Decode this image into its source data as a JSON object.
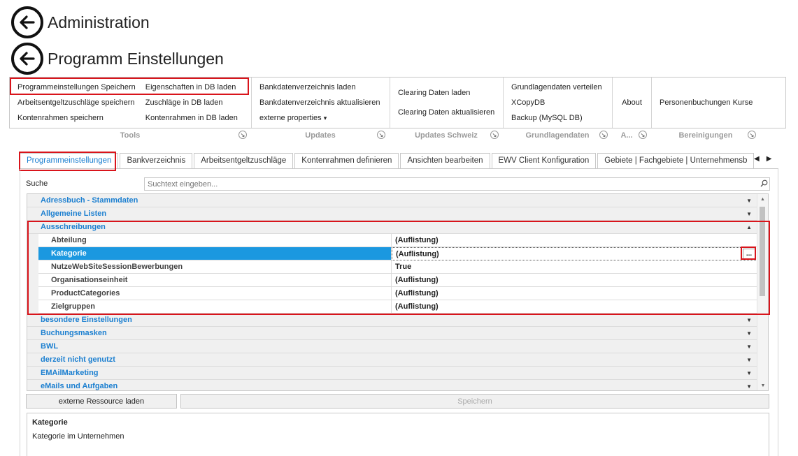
{
  "header": {
    "title1": "Administration",
    "title2": "Programm Einstellungen"
  },
  "ribbon": {
    "groups": [
      {
        "label": "Tools",
        "buttons": [
          [
            "Programmeinstellungen Speichern",
            "Arbeitsentgeltzuschläge speichern",
            "Kontenrahmen speichern"
          ],
          [
            "Eigenschaften in DB laden",
            "Zuschläge in DB laden",
            "Kontenrahmen in DB laden"
          ]
        ]
      },
      {
        "label": "Updates",
        "buttons": [
          [
            "Bankdatenverzeichnis laden",
            "Bankdatenverzeichnis aktualisieren",
            "externe properties"
          ]
        ]
      },
      {
        "label": "Updates Schweiz",
        "buttons": [
          [
            "Clearing Daten laden",
            "Clearing Daten aktualisieren"
          ]
        ]
      },
      {
        "label": "Grundlagendaten",
        "buttons": [
          [
            "Grundlagendaten verteilen",
            "XCopyDB",
            "Backup (MySQL DB)"
          ]
        ]
      },
      {
        "label": "A...",
        "buttons": [
          [
            "About"
          ]
        ]
      },
      {
        "label": "Bereinigungen",
        "buttons": [
          [
            "Personenbuchungen Kurse"
          ]
        ]
      }
    ],
    "dropdown_arrow": "▾"
  },
  "tabs": [
    "Programmeinstellungen",
    "Bankverzeichnis",
    "Arbeitsentgeltzuschläge",
    "Kontenrahmen definieren",
    "Ansichten bearbeiten",
    "EWV Client Konfiguration",
    "Gebiete | Fachgebiete | Unternehmensb"
  ],
  "active_tab": "Programmeinstellungen",
  "search": {
    "label": "Suche",
    "placeholder": "Suchtext eingeben..."
  },
  "grid": {
    "categories_before": [
      "Adressbuch - Stammdaten",
      "Allgemeine Listen"
    ],
    "expanded_category": "Ausschreibungen",
    "properties": [
      {
        "name": "Abteilung",
        "value": "(Auflistung)"
      },
      {
        "name": "Kategorie",
        "value": "(Auflistung)",
        "selected": true
      },
      {
        "name": "NutzeWebSiteSessionBewerbungen",
        "value": "True"
      },
      {
        "name": "Organisationseinheit",
        "value": "(Auflistung)"
      },
      {
        "name": "ProductCategories",
        "value": "(Auflistung)"
      },
      {
        "name": "Zielgruppen",
        "value": "(Auflistung)"
      }
    ],
    "categories_after": [
      "besondere Einstellungen",
      "Buchungsmasken",
      "BWL",
      "derzeit nicht genutzt",
      "EMAilMarketing",
      "eMails und Aufgaben"
    ],
    "ellipsis": "..."
  },
  "buttons": {
    "load_resource": "externe Ressource laden",
    "save": "Speichern"
  },
  "description": {
    "title": "Kategorie",
    "text": "Kategorie im Unternehmen"
  },
  "colors": {
    "accent": "#1b7fd0",
    "selection": "#1b98e0",
    "highlight": "#d9141b"
  }
}
